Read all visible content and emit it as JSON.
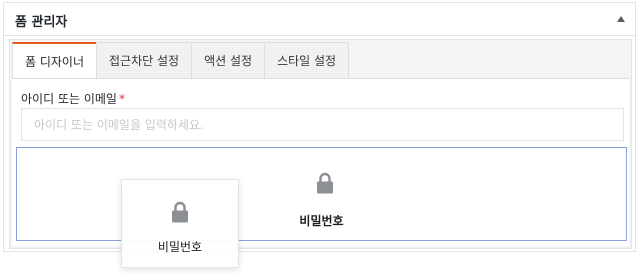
{
  "panel": {
    "title": "폼 관리자"
  },
  "tabs": [
    {
      "label": "폼 디자이너",
      "active": true
    },
    {
      "label": "접근차단 설정",
      "active": false
    },
    {
      "label": "액션 설정",
      "active": false
    },
    {
      "label": "스타일 설정",
      "active": false
    }
  ],
  "field": {
    "label": "아이디 또는 이메일",
    "required_mark": "*",
    "placeholder": "아이디 또는 이메일을 입력하세요."
  },
  "dropzone": {
    "icon": "lock-icon",
    "label": "비밀번호"
  },
  "drag_card": {
    "icon": "lock-icon",
    "label": "비밀번호"
  },
  "colors": {
    "accent": "#e35d18",
    "dropzone_border": "#8c9fd9",
    "required": "#d63638",
    "icon": "#8c8f94"
  }
}
